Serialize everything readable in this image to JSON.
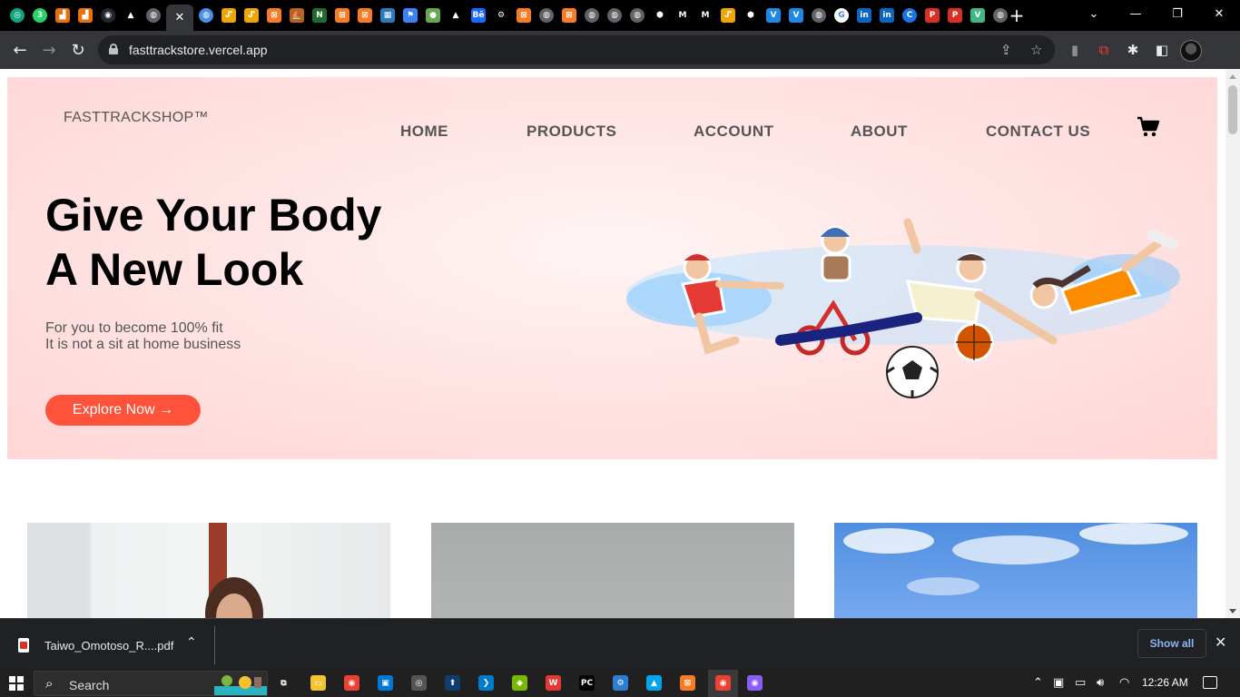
{
  "browser": {
    "tabs": [
      {
        "icon": "chatgpt-icon",
        "color": "#10a37f",
        "glyph": "◎"
      },
      {
        "icon": "whatsapp-badge-icon",
        "color": "#25d366",
        "glyph": "3"
      },
      {
        "icon": "analytics-icon",
        "color": "#e8710a",
        "glyph": "▟"
      },
      {
        "icon": "analytics-icon",
        "color": "#e8710a",
        "glyph": "▟"
      },
      {
        "icon": "github-icon",
        "color": "#24292f",
        "glyph": "◉"
      },
      {
        "icon": "vercel-icon",
        "color": "#000000",
        "glyph": "▲"
      },
      {
        "icon": "globe-icon",
        "color": "#5f6368",
        "glyph": "◍"
      },
      {
        "icon": "active-tab-close-icon",
        "color": "#35363a",
        "glyph": "✕"
      },
      {
        "icon": "globe-blue-icon",
        "color": "#4a90e2",
        "glyph": "◍"
      },
      {
        "icon": "orange-swirl-icon",
        "color": "#f0a500",
        "glyph": "ᔑ"
      },
      {
        "icon": "orange-swirl-icon",
        "color": "#f0a500",
        "glyph": "ᔑ"
      },
      {
        "icon": "xampp-icon",
        "color": "#fb7a24",
        "glyph": "⊠"
      },
      {
        "icon": "ship-icon",
        "color": "#b5651d",
        "glyph": "⛵"
      },
      {
        "icon": "green-n-icon",
        "color": "#1e6b2f",
        "glyph": "N"
      },
      {
        "icon": "xampp-icon",
        "color": "#fb7a24",
        "glyph": "⊠"
      },
      {
        "icon": "xampp-icon",
        "color": "#fb7a24",
        "glyph": "⊠"
      },
      {
        "icon": "grid-icon",
        "color": "#2b7bb9",
        "glyph": "▦"
      },
      {
        "icon": "flag-icon",
        "color": "#3b82f6",
        "glyph": "⚑"
      },
      {
        "icon": "green-pill-icon",
        "color": "#6aa84f",
        "glyph": "●"
      },
      {
        "icon": "vercel-icon",
        "color": "#000000",
        "glyph": "▲"
      },
      {
        "icon": "behance-icon",
        "color": "#1769ff",
        "glyph": "Bē"
      },
      {
        "icon": "settings-gear-icon",
        "color": "#000000",
        "glyph": "⚙"
      },
      {
        "icon": "xampp-icon",
        "color": "#fb7a24",
        "glyph": "⊠"
      },
      {
        "icon": "globe-icon",
        "color": "#5f6368",
        "glyph": "◍"
      },
      {
        "icon": "xampp-icon",
        "color": "#fb7a24",
        "glyph": "⊠"
      },
      {
        "icon": "globe-icon",
        "color": "#5f6368",
        "glyph": "◍"
      },
      {
        "icon": "globe-icon",
        "color": "#5f6368",
        "glyph": "◍"
      },
      {
        "icon": "globe-icon",
        "color": "#5f6368",
        "glyph": "◍"
      },
      {
        "icon": "hexagon-icon",
        "color": "#000000",
        "glyph": "⬢"
      },
      {
        "icon": "gmail-icon",
        "color": "#000000",
        "glyph": "M"
      },
      {
        "icon": "gmail-icon",
        "color": "#000000",
        "glyph": "M"
      },
      {
        "icon": "orange-swirl-icon",
        "color": "#f0a500",
        "glyph": "ᔑ"
      },
      {
        "icon": "hexagon-icon",
        "color": "#000000",
        "glyph": "⬢"
      },
      {
        "icon": "vue-v-icon",
        "color": "#1e88e5",
        "glyph": "V"
      },
      {
        "icon": "vue-v-icon",
        "color": "#1e88e5",
        "glyph": "V"
      },
      {
        "icon": "globe-icon",
        "color": "#5f6368",
        "glyph": "◍"
      },
      {
        "icon": "google-icon",
        "color": "#ffffff",
        "glyph": "G"
      },
      {
        "icon": "linkedin-icon",
        "color": "#0a66c2",
        "glyph": "in"
      },
      {
        "icon": "linkedin-icon",
        "color": "#0a66c2",
        "glyph": "in"
      },
      {
        "icon": "c-circle-icon",
        "color": "#1a73e8",
        "glyph": "C"
      },
      {
        "icon": "p-red-icon",
        "color": "#d93025",
        "glyph": "P"
      },
      {
        "icon": "p-red-icon",
        "color": "#d93025",
        "glyph": "P"
      },
      {
        "icon": "vue-icon",
        "color": "#41b883",
        "glyph": "V"
      },
      {
        "icon": "globe-icon",
        "color": "#5f6368",
        "glyph": "◍"
      }
    ],
    "url": "fasttrackstore.vercel.app"
  },
  "site": {
    "brand": "FASTTRACKSHOP™",
    "nav": [
      "HOME",
      "PRODUCTS",
      "ACCOUNT",
      "ABOUT",
      "CONTACT US"
    ],
    "headline_line1": "Give Your Body",
    "headline_line2": "A New Look",
    "sub_line1": "For you to become 100% fit",
    "sub_line2": "It is not a sit at home business",
    "cta": "Explore Now →",
    "accent_color": "#ff523b"
  },
  "downloads": {
    "file_name": "Taiwo_Omotoso_R....pdf",
    "show_all": "Show all"
  },
  "taskbar": {
    "search_placeholder": "Search",
    "apps": [
      {
        "icon": "task-view-icon",
        "color": "#202020",
        "glyph": "⧉"
      },
      {
        "icon": "file-explorer-icon",
        "color": "#f4c430",
        "glyph": "▭"
      },
      {
        "icon": "chrome-icon",
        "color": "#ea4335",
        "glyph": "◉"
      },
      {
        "icon": "store-icon",
        "color": "#0078d4",
        "glyph": "▣"
      },
      {
        "icon": "obs-icon",
        "color": "#555555",
        "glyph": "◎"
      },
      {
        "icon": "upload-app-icon",
        "color": "#0f3d6e",
        "glyph": "⬆"
      },
      {
        "icon": "vscode-icon",
        "color": "#007acc",
        "glyph": "❯"
      },
      {
        "icon": "nvidia-icon",
        "color": "#76b900",
        "glyph": "◆"
      },
      {
        "icon": "wps-icon",
        "color": "#e53935",
        "glyph": "W"
      },
      {
        "icon": "pycharm-icon",
        "color": "#000000",
        "glyph": "PC"
      },
      {
        "icon": "settings-app-icon",
        "color": "#2d7dd2",
        "glyph": "⚙"
      },
      {
        "icon": "photos-icon",
        "color": "#00a4ef",
        "glyph": "▲"
      },
      {
        "icon": "xampp-icon",
        "color": "#fb7a24",
        "glyph": "⊠"
      },
      {
        "icon": "chrome-active-icon",
        "color": "#ea4335",
        "glyph": "◉"
      },
      {
        "icon": "github-desktop-icon",
        "color": "#8b5cf6",
        "glyph": "◉"
      }
    ],
    "time": "12:26 AM"
  }
}
